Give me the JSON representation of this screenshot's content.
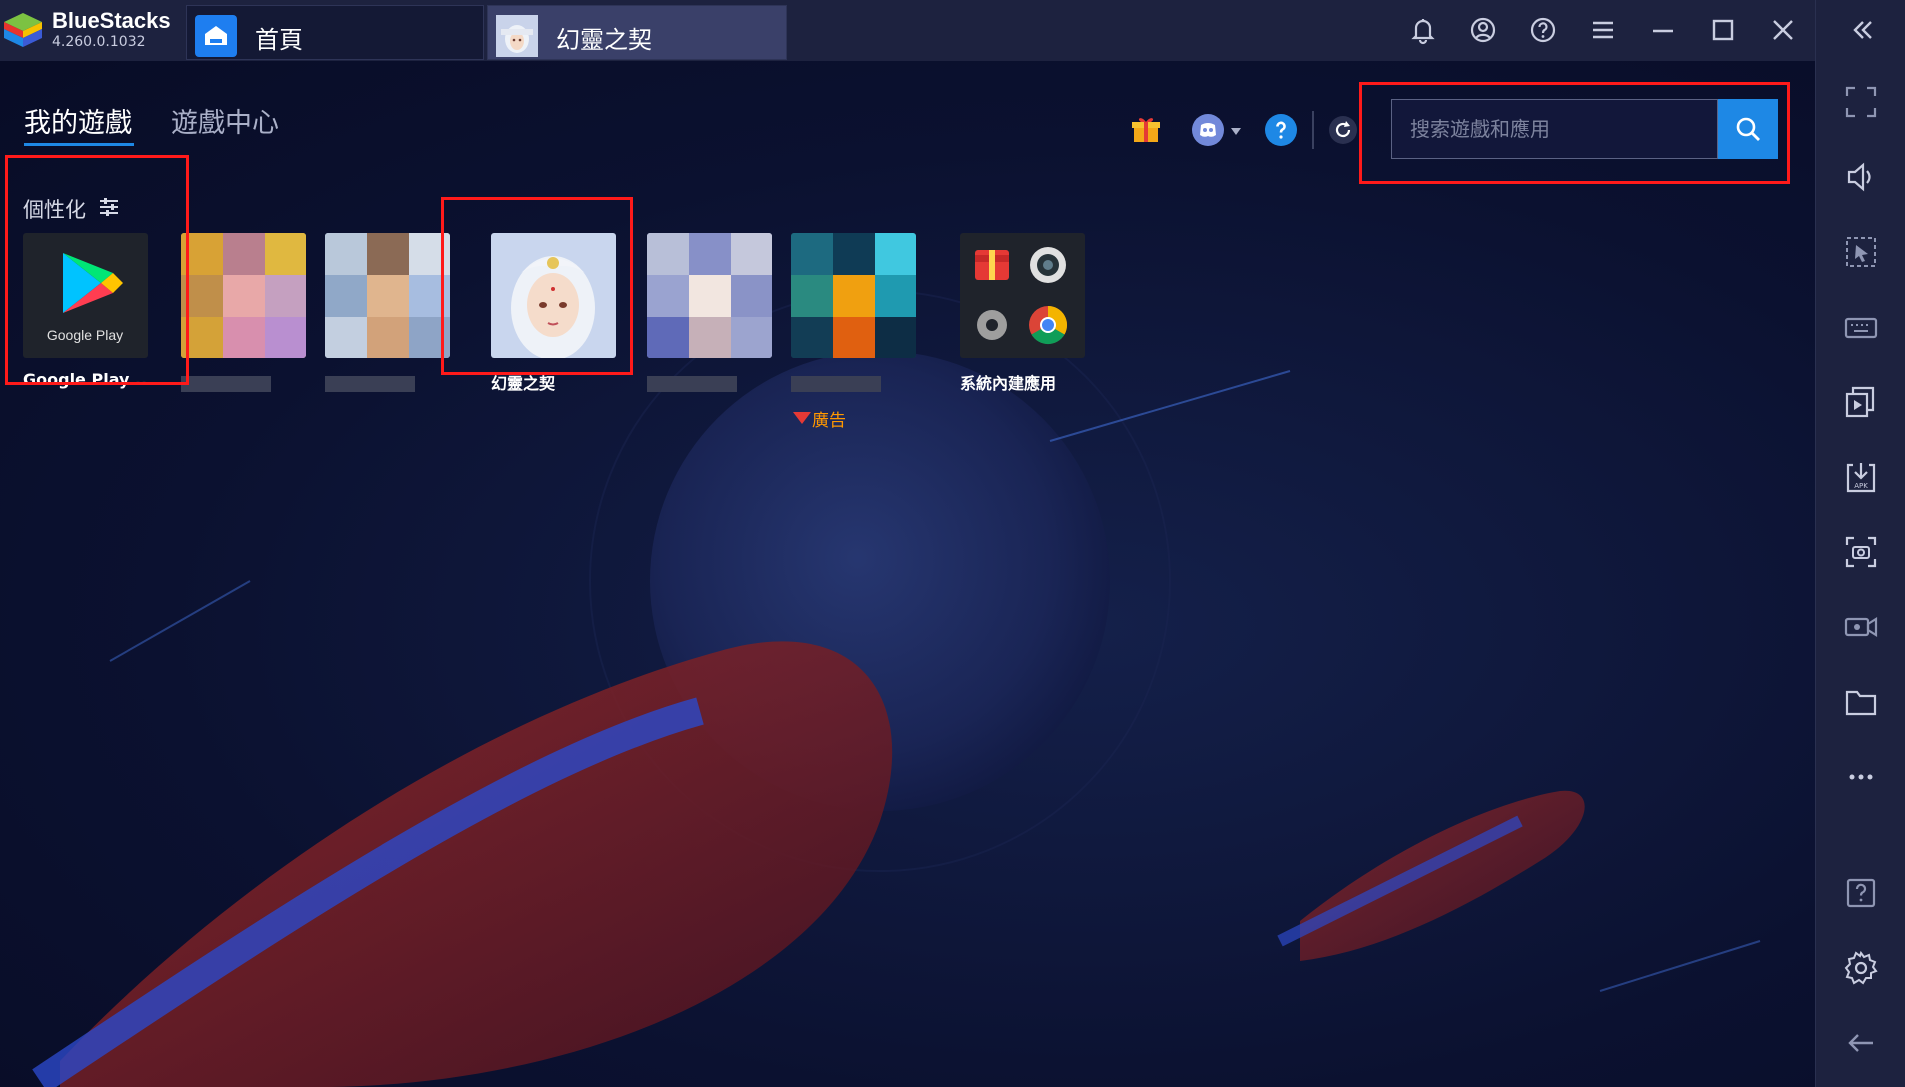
{
  "titlebar": {
    "brand_name": "BlueStacks",
    "brand_version": "4.260.0.1032",
    "tabs": [
      {
        "label": "首頁",
        "icon": "home-icon"
      },
      {
        "label": "幻靈之契",
        "icon": "game-thumbnail"
      }
    ],
    "icons": [
      "bell-icon",
      "account-icon",
      "help-icon",
      "menu-icon",
      "minimize-icon",
      "maximize-icon",
      "close-icon",
      "collapse-sidebar-icon"
    ]
  },
  "main": {
    "nav_tabs": [
      {
        "label": "我的遊戲",
        "active": true
      },
      {
        "label": "遊戲中心",
        "active": false
      }
    ],
    "utility_icons": [
      "gift-icon",
      "discord-icon",
      "help-circle-icon",
      "refresh-icon"
    ],
    "search": {
      "placeholder": "搜索遊戲和應用",
      "value": ""
    },
    "section_label": "個性化",
    "apps": [
      {
        "name": "Google Play ..."
      },
      {
        "name": ""
      },
      {
        "name": ""
      },
      {
        "name": "幻靈之契"
      },
      {
        "name": ""
      },
      {
        "name": "",
        "ad_label": "廣告"
      },
      {
        "name": "系統內建應用"
      }
    ]
  },
  "rightbar": {
    "icons": [
      "fullscreen-icon",
      "volume-icon",
      "pointer-icon",
      "keyboard-icon",
      "multi-instance-icon",
      "apk-install-icon",
      "screenshot-icon",
      "record-icon",
      "folder-icon",
      "more-icon",
      "help-box-icon",
      "settings-icon",
      "back-icon"
    ]
  },
  "colors": {
    "accent": "#1e88e5",
    "highlight": "#ff1a1a",
    "ad_text": "#ff9800",
    "titlebar_bg": "#1d223f",
    "main_bg": "#0b1130"
  }
}
